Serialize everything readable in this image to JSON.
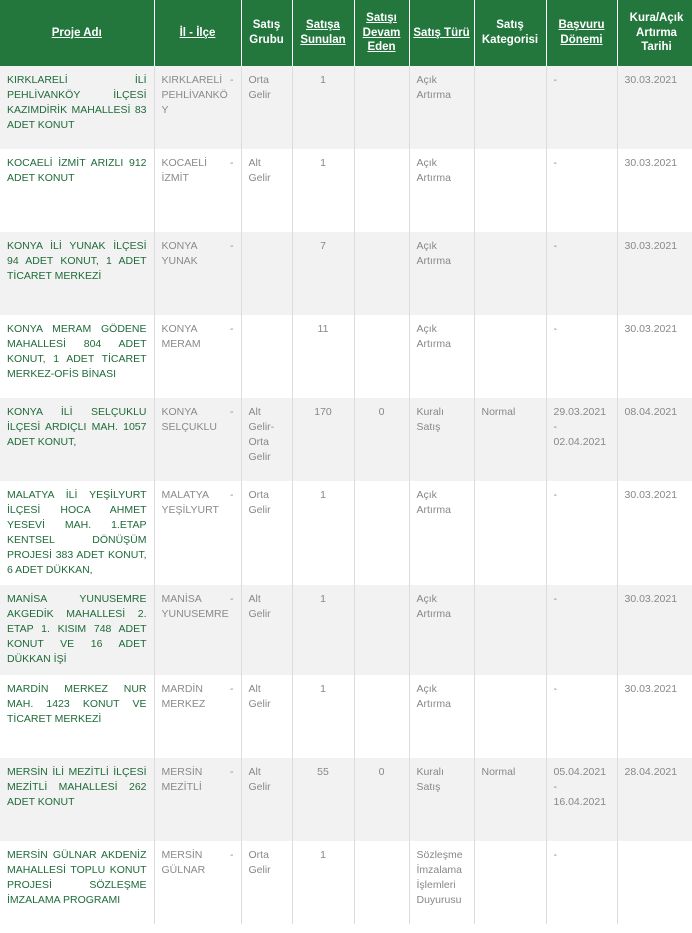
{
  "headers": {
    "proje_adi": "Proje Adı",
    "il_ilce": "İl - İlçe",
    "satis_grubu": "Satış Grubu",
    "satisa_sunulan": "Satışa Sunulan",
    "satisi_devam_eden": "Satışı Devam Eden",
    "satis_turu": "Satış Türü",
    "satis_kategorisi": "Satış Kategorisi",
    "basvuru_donemi": "Başvuru Dönemi",
    "kura_tarihi": "Kura/Açık Artırma Tarihi"
  },
  "rows": [
    {
      "proje": "KIRKLARELİ İLİ PEHLİVANKÖY İLÇESİ KAZIMDİRİK MAHALLESİ 83 ADET KONUT",
      "il": "KIRKLARELİ",
      "ilce": "PEHLİVANKÖY",
      "il_sep": "-",
      "grup": "Orta Gelir",
      "sunulan": "1",
      "devam": "",
      "tur": "Açık Artırma",
      "kategori": "",
      "basvuru": "-",
      "tarih": "30.03.2021"
    },
    {
      "proje": "KOCAELİ İZMİT ARIZLI 912 ADET KONUT",
      "il": "KOCAELİ",
      "ilce": "İZMİT",
      "il_sep": "-",
      "grup": "Alt Gelir",
      "sunulan": "1",
      "devam": "",
      "tur": "Açık Artırma",
      "kategori": "",
      "basvuru": "-",
      "tarih": "30.03.2021"
    },
    {
      "proje": "KONYA İLİ YUNAK İLÇESİ 94 ADET KONUT, 1 ADET TİCARET MERKEZİ",
      "il": "KONYA",
      "ilce": "YUNAK",
      "il_sep": "-",
      "grup": "",
      "sunulan": "7",
      "devam": "",
      "tur": "Açık Artırma",
      "kategori": "",
      "basvuru": "-",
      "tarih": "30.03.2021"
    },
    {
      "proje": "KONYA MERAM GÖDENE MAHALLESİ 804 ADET KONUT, 1 ADET TİCARET MERKEZ-OFİS BİNASI",
      "il": "KONYA",
      "ilce": "MERAM",
      "il_sep": "-",
      "grup": "",
      "sunulan": "11",
      "devam": "",
      "tur": "Açık Artırma",
      "kategori": "",
      "basvuru": "-",
      "tarih": "30.03.2021"
    },
    {
      "proje": "KONYA İLİ SELÇUKLU İLÇESİ ARDIÇLI MAH. 1057 ADET KONUT,",
      "il": "KONYA",
      "ilce": "SELÇUKLU",
      "il_sep": "-",
      "grup": "Alt Gelir-Orta Gelir",
      "sunulan": "170",
      "devam": "0",
      "tur": "Kuralı Satış",
      "kategori": "Normal",
      "basvuru": "29.03.2021 - 02.04.2021",
      "tarih": "08.04.2021"
    },
    {
      "proje": "MALATYA İLİ YEŞİLYURT İLÇESİ HOCA AHMET YESEVİ MAH. 1.ETAP KENTSEL DÖNÜŞÜM PROJESİ 383 ADET KONUT, 6 ADET DÜKKAN,",
      "il": "MALATYA",
      "ilce": "YEŞİLYURT",
      "il_sep": "-",
      "grup": "Orta Gelir",
      "sunulan": "1",
      "devam": "",
      "tur": "Açık Artırma",
      "kategori": "",
      "basvuru": "-",
      "tarih": "30.03.2021"
    },
    {
      "proje": "MANİSA YUNUSEMRE AKGEDİK MAHALLESİ 2. ETAP 1. KISIM 748 ADET KONUT VE 16 ADET DÜKKAN İŞİ",
      "il": "MANİSA",
      "ilce": "YUNUSEMRE",
      "il_sep": "-",
      "grup": "Alt Gelir",
      "sunulan": "1",
      "devam": "",
      "tur": "Açık Artırma",
      "kategori": "",
      "basvuru": "-",
      "tarih": "30.03.2021"
    },
    {
      "proje": "MARDİN MERKEZ NUR MAH. 1423 KONUT VE TİCARET MERKEZİ",
      "il": "MARDİN",
      "ilce": "MERKEZ",
      "il_sep": "-",
      "grup": "Alt Gelir",
      "sunulan": "1",
      "devam": "",
      "tur": "Açık Artırma",
      "kategori": "",
      "basvuru": "-",
      "tarih": "30.03.2021"
    },
    {
      "proje": "MERSİN İLİ MEZİTLİ İLÇESİ MEZİTLİ MAHALLESİ 262 ADET KONUT",
      "il": "MERSİN",
      "ilce": "MEZİTLİ",
      "il_sep": "-",
      "grup": "Alt Gelir",
      "sunulan": "55",
      "devam": "0",
      "tur": "Kuralı Satış",
      "kategori": "Normal",
      "basvuru": "05.04.2021 - 16.04.2021",
      "tarih": "28.04.2021"
    },
    {
      "proje": "MERSİN GÜLNAR AKDENİZ MAHALLESİ TOPLU KONUT PROJESİ SÖZLEŞME İMZALAMA PROGRAMI",
      "il": "MERSİN",
      "ilce": "GÜLNAR",
      "il_sep": "-",
      "grup": "Orta Gelir",
      "sunulan": "1",
      "devam": "",
      "tur": "Sözleşme İmzalama İşlemleri Duyurusu",
      "kategori": "",
      "basvuru": "-",
      "tarih": ""
    }
  ]
}
